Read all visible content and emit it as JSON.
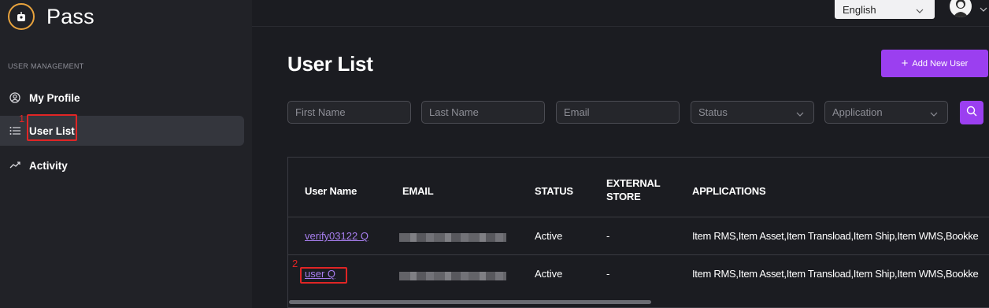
{
  "app": {
    "name": "Pass"
  },
  "sidebar": {
    "section_label": "USER MANAGEMENT",
    "items": [
      {
        "label": "My Profile",
        "icon": "user-circle-icon"
      },
      {
        "label": "User List",
        "icon": "list-icon"
      },
      {
        "label": "Activity",
        "icon": "trend-icon"
      }
    ]
  },
  "header": {
    "language": "English"
  },
  "main": {
    "title": "User List",
    "add_button": "Add New User",
    "filters": {
      "first_name": "First Name",
      "last_name": "Last Name",
      "email": "Email",
      "status": "Status",
      "application": "Application"
    },
    "table": {
      "columns": [
        "User Name",
        "EMAIL",
        "STATUS",
        "EXTERNAL STORE",
        "APPLICATIONS"
      ],
      "external_store_line1": "EXTERNAL",
      "external_store_line2": "STORE",
      "rows": [
        {
          "user_name": "verify03122 Q",
          "status": "Active",
          "external_store": "-",
          "applications": "Item RMS,Item Asset,Item Transload,Item Ship,Item WMS,Bookke"
        },
        {
          "user_name": "user Q",
          "status": "Active",
          "external_store": "-",
          "applications": "Item RMS,Item Asset,Item Transload,Item Ship,Item WMS,Bookke"
        }
      ]
    }
  },
  "annotations": {
    "marker1": "1",
    "marker2": "2"
  },
  "colors": {
    "accent": "#9b3ff0",
    "highlight": "#e02525",
    "logo": "#e8a33d"
  }
}
